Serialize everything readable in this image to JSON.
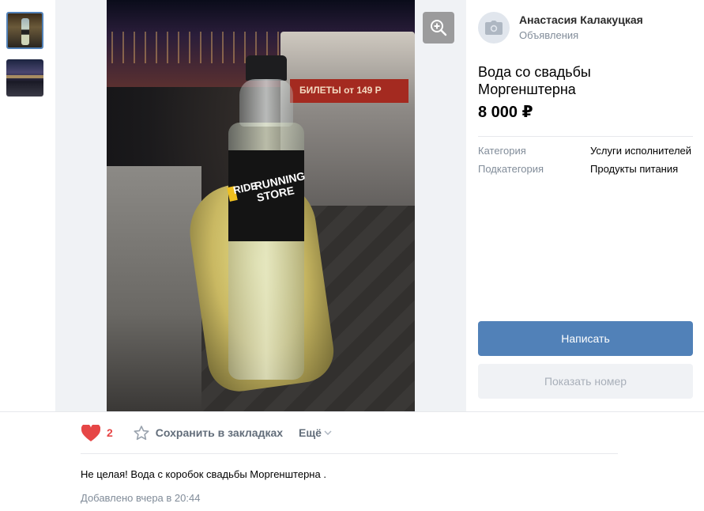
{
  "thumbnails": [
    {
      "label": "photo-1",
      "selected": true
    },
    {
      "label": "photo-2",
      "selected": false
    }
  ],
  "photo": {
    "bottle_label_left": "RIDE",
    "bottle_label_right": "RUNNING STORE",
    "banner_text": "БИЛЕТЫ от 149 Р"
  },
  "author": {
    "name": "Анастасия Калакуцкая",
    "subtitle": "Объявления"
  },
  "listing": {
    "title": "Вода со свадьбы Моргенштерна",
    "price": "8 000 ₽",
    "properties": [
      {
        "key": "Категория",
        "value": "Услуги исполнителей"
      },
      {
        "key": "Подкатегория",
        "value": "Продукты питания"
      }
    ]
  },
  "buttons": {
    "write": "Написать",
    "show_phone": "Показать номер"
  },
  "actions": {
    "likes": "2",
    "save": "Сохранить в закладках",
    "more": "Ещё"
  },
  "description": "Не целая! Вода с коробок свадьбы Моргенштерна .",
  "posted": "Добавлено вчера в 20:44",
  "colors": {
    "accent": "#5181b8",
    "like": "#e64646",
    "muted": "#818c99"
  },
  "icons": {
    "zoom": "zoom-in-icon",
    "avatar": "camera-icon",
    "like": "heart-icon",
    "save": "star-icon",
    "more": "chevron-down-icon"
  }
}
